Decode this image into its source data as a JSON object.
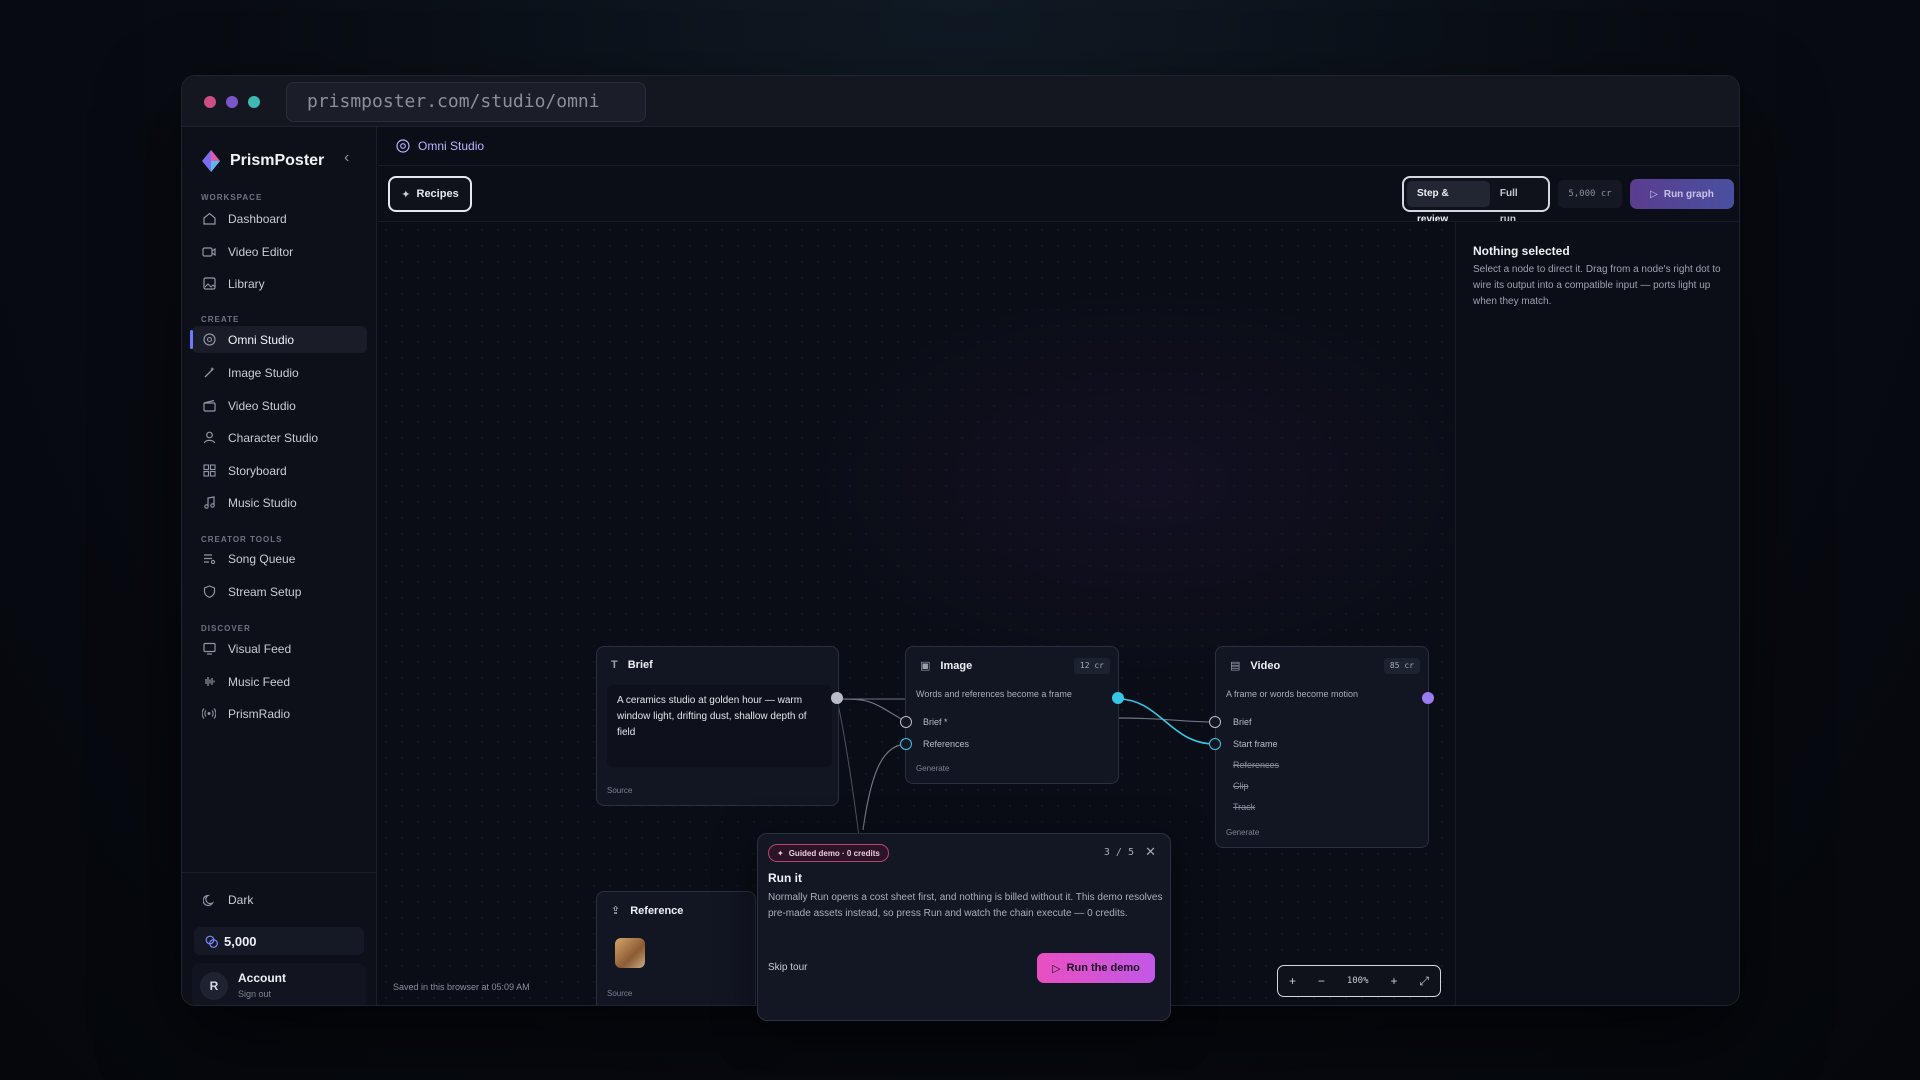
{
  "browser": {
    "url": "prismposter.com/studio/omni",
    "dot_colors": [
      "#c94f84",
      "#7b56c9",
      "#3fb8b2"
    ]
  },
  "sidebar": {
    "brand": "PrismPoster",
    "sections": {
      "workspace": "WORKSPACE",
      "create": "CREATE",
      "creator_tools": "CREATOR TOOLS",
      "discover": "DISCOVER"
    },
    "workspace_items": [
      {
        "label": "Dashboard",
        "icon": "home-icon"
      },
      {
        "label": "Video Editor",
        "icon": "video-camera-icon"
      },
      {
        "label": "Library",
        "icon": "image-icon"
      }
    ],
    "create_items": [
      {
        "label": "Omni Studio",
        "icon": "omni-icon",
        "active": true
      },
      {
        "label": "Image Studio",
        "icon": "wand-icon"
      },
      {
        "label": "Video Studio",
        "icon": "clapper-icon"
      },
      {
        "label": "Character Studio",
        "icon": "person-icon"
      },
      {
        "label": "Storyboard",
        "icon": "grid-icon"
      },
      {
        "label": "Music Studio",
        "icon": "music-note-icon"
      }
    ],
    "creator_tools_items": [
      {
        "label": "Song Queue",
        "icon": "queue-icon"
      },
      {
        "label": "Stream Setup",
        "icon": "shield-icon"
      }
    ],
    "discover_items": [
      {
        "label": "Visual Feed",
        "icon": "monitor-icon"
      },
      {
        "label": "Music Feed",
        "icon": "waveform-icon"
      },
      {
        "label": "PrismRadio",
        "icon": "radio-icon"
      }
    ],
    "theme_label": "Dark",
    "credits": "5,000",
    "account": {
      "initial": "R",
      "name": "Account",
      "sub": "Sign out"
    }
  },
  "header": {
    "breadcrumb": "Omni Studio",
    "recipes_label": "Recipes",
    "mode_step": "Step & review",
    "mode_full": "Full run",
    "credits_pill": "5,000 cr",
    "run_graph_label": "Run graph"
  },
  "inspector": {
    "title": "Nothing selected",
    "text": "Select a node to direct it. Drag from a node's right dot to wire its output into a compatible input — ports light up when they match."
  },
  "nodes": {
    "brief": {
      "title": "Brief",
      "text": "A ceramics studio at golden hour — warm window light, drifting dust, shallow depth of field",
      "footer": "Source"
    },
    "image": {
      "title": "Image",
      "cost": "12 cr",
      "desc": "Words and references become a frame",
      "ports": [
        "Brief *",
        "References"
      ],
      "footer": "Generate"
    },
    "video": {
      "title": "Video",
      "cost": "85 cr",
      "desc": "A frame or words become motion",
      "ports": [
        "Brief",
        "Start frame",
        "References",
        "Clip",
        "Track"
      ],
      "footer": "Generate"
    },
    "reference": {
      "title": "Reference",
      "footer": "Source"
    }
  },
  "tour": {
    "chip": "Guided demo · 0 credits",
    "step": "3 / 5",
    "title": "Run it",
    "body": "Normally Run opens a cost sheet first, and nothing is billed without it. This demo resolves pre-made assets instead, so press Run and watch the chain execute — 0 credits.",
    "skip": "Skip tour",
    "run": "Run the demo"
  },
  "zoom": {
    "level": "100%"
  },
  "status": {
    "saved": "Saved in this browser at 05:09 AM"
  },
  "colors": {
    "accent_purple": "#8b7cff",
    "port_cyan": "#37c6e6",
    "port_violet": "#9a7cf2",
    "run_pink": "#e94fc1"
  }
}
